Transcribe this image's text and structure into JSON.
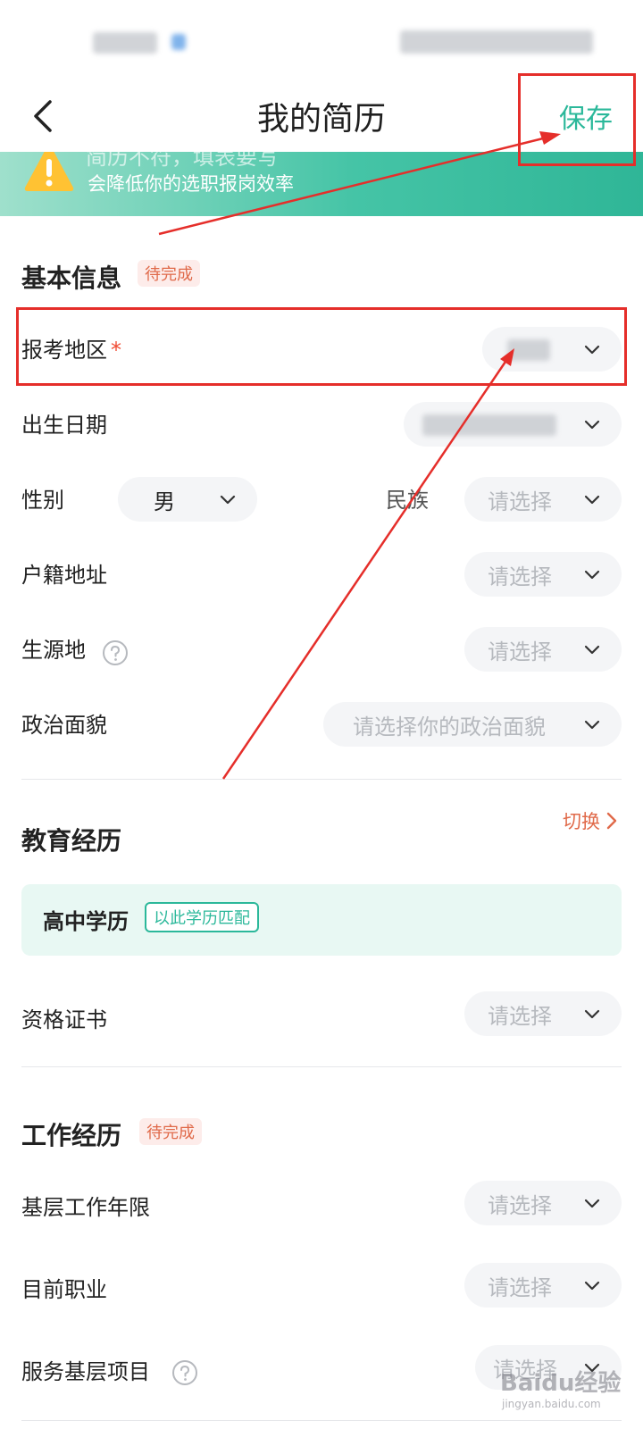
{
  "header": {
    "title": "我的简历",
    "save_label": "保存"
  },
  "banner": {
    "line1": "简历不符，填表要写",
    "line2": "会降低你的选职报岗效率"
  },
  "basic": {
    "title": "基本信息",
    "badge": "待完成",
    "region_label": "报考地区",
    "required_mark": "*",
    "birth_label": "出生日期",
    "gender_label": "性别",
    "gender_value": "男",
    "ethnicity_label": "民族",
    "ethnicity_placeholder": "请选择",
    "hukou_label": "户籍地址",
    "hukou_placeholder": "请选择",
    "origin_label": "生源地",
    "origin_placeholder": "请选择",
    "political_label": "政治面貌",
    "political_placeholder": "请选择你的政治面貌"
  },
  "education": {
    "title": "教育经历",
    "switch_label": "切换",
    "card_title": "高中学历",
    "card_tag": "以此学历匹配",
    "cert_label": "资格证书",
    "cert_placeholder": "请选择"
  },
  "work": {
    "title": "工作经历",
    "badge": "待完成",
    "years_label": "基层工作年限",
    "years_placeholder": "请选择",
    "job_label": "目前职业",
    "job_placeholder": "请选择",
    "project_label": "服务基层项目",
    "project_placeholder": "请选择"
  },
  "watermark": {
    "main": "Baidu经验",
    "sub": "jingyan.baidu.com"
  },
  "colors": {
    "accent": "#2bb89a",
    "warning": "#e06a4a",
    "annotation": "#e52e2a"
  },
  "icons": {
    "back": "chevron-left-icon",
    "dropdown": "chevron-down-icon",
    "help": "question-circle-icon",
    "warning": "warning-triangle-icon"
  }
}
